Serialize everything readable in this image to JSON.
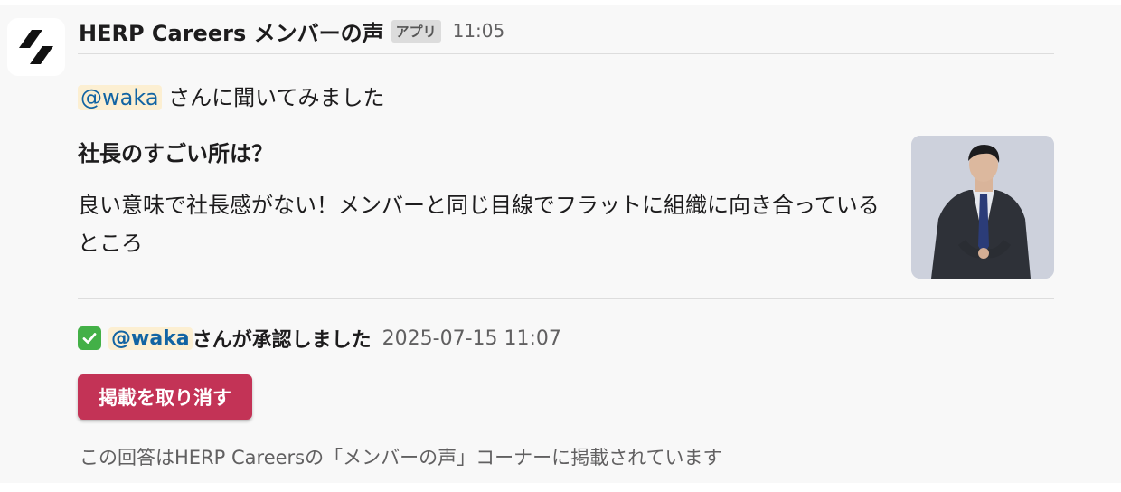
{
  "header": {
    "sender": "HERP Careers メンバーの声",
    "badge": "アプリ",
    "time": "11:05",
    "logo_icon": "herp-logo-icon"
  },
  "intro": {
    "mention": "@waka",
    "text": " さんに聞いてみました"
  },
  "question": "社長のすごい所は？",
  "answer": "良い意味で社長感がない！メンバーと同じ目線でフラットに組織に向き合っているところ",
  "photo": {
    "icon": "member-photo"
  },
  "approval": {
    "icon": "white-check-mark-icon",
    "mention": "@waka",
    "text": "さんが承認しました",
    "timestamp": "2025-07-15 11:07"
  },
  "actions": {
    "unpublish_label": "掲載を取り消す"
  },
  "footnote": "この回答はHERP Careersの「メンバーの声」コーナーに掲載されています",
  "colors": {
    "button": "#c33356",
    "mention_bg": "#fcefd2",
    "mention_fg": "#1264a3",
    "check": "#43b047"
  }
}
